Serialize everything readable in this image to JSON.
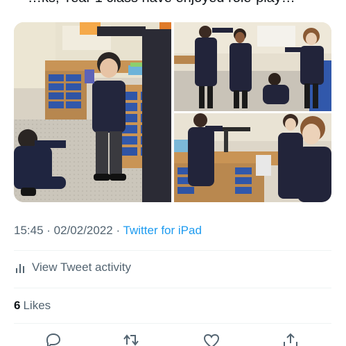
{
  "tweet": {
    "text_fragment": "…ks, Year 1 class have enjoyed role-play…",
    "timestamp": "15:45 · 02/02/2022",
    "separator": " · ",
    "source": "Twitter for iPad"
  },
  "media": {
    "count": 3
  },
  "activity": {
    "label": "View Tweet activity",
    "icon": "bar-chart-icon"
  },
  "likes": {
    "count": "6",
    "label": "Likes"
  },
  "actions": [
    {
      "name": "reply",
      "icon": "reply-icon"
    },
    {
      "name": "retweet",
      "icon": "retweet-icon"
    },
    {
      "name": "like",
      "icon": "heart-icon"
    },
    {
      "name": "share",
      "icon": "share-icon"
    }
  ],
  "colors": {
    "link": "#1d9bf0",
    "secondary_text": "#536471",
    "primary_text": "#0f1419",
    "divider": "#eff3f4"
  }
}
